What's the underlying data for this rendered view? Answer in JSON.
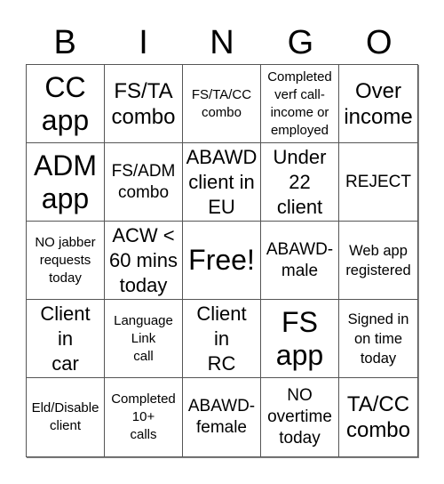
{
  "title_letters": [
    "B",
    "I",
    "N",
    "G",
    "O"
  ],
  "cells": [
    {
      "text": "CC\napp",
      "size": "s-xl"
    },
    {
      "text": "FS/TA\ncombo",
      "size": "s-l"
    },
    {
      "text": "FS/TA/CC\ncombo",
      "size": "s-s"
    },
    {
      "text": "Completed\nverf call-\nincome or\nemployed",
      "size": "s-s"
    },
    {
      "text": "Over\nincome",
      "size": "s-l"
    },
    {
      "text": "ADM\napp",
      "size": "s-xl"
    },
    {
      "text": "FS/ADM\ncombo",
      "size": "s-m"
    },
    {
      "text": "ABAWD\nclient in\nEU",
      "size": "s-ml"
    },
    {
      "text": "Under\n22\nclient",
      "size": "s-ml"
    },
    {
      "text": "REJECT",
      "size": "s-m"
    },
    {
      "text": "NO jabber\nrequests\ntoday",
      "size": "s-s"
    },
    {
      "text": "ACW <\n60 mins\ntoday",
      "size": "s-ml"
    },
    {
      "text": "Free!",
      "size": "s-xl"
    },
    {
      "text": "ABAWD-\nmale",
      "size": "s-m"
    },
    {
      "text": "Web app\nregistered",
      "size": "s-sm"
    },
    {
      "text": "Client\nin\ncar",
      "size": "s-ml"
    },
    {
      "text": "Language\nLink\ncall",
      "size": "s-s"
    },
    {
      "text": "Client\nin\nRC",
      "size": "s-ml"
    },
    {
      "text": "FS\napp",
      "size": "s-xl"
    },
    {
      "text": "Signed in\non time\ntoday",
      "size": "s-sm"
    },
    {
      "text": "Eld/Disable\nclient",
      "size": "s-s"
    },
    {
      "text": "Completed\n10+\ncalls",
      "size": "s-s"
    },
    {
      "text": "ABAWD-\nfemale",
      "size": "s-m"
    },
    {
      "text": "NO\novertime\ntoday",
      "size": "s-m"
    },
    {
      "text": "TA/CC\ncombo",
      "size": "s-l"
    }
  ]
}
